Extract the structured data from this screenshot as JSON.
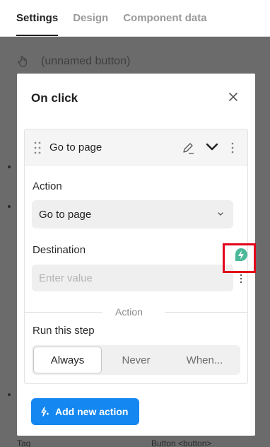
{
  "tabs": [
    {
      "label": "Settings",
      "active": true
    },
    {
      "label": "Design",
      "active": false
    },
    {
      "label": "Component data",
      "active": false
    }
  ],
  "background": {
    "component_name": "(unnamed button)",
    "bottom_left": "Tag",
    "bottom_right": "Button <button>"
  },
  "modal": {
    "title": "On click",
    "step": {
      "title": "Go to page",
      "action_label": "Action",
      "action_value": "Go to page",
      "destination_label": "Destination",
      "destination_placeholder": "Enter value",
      "separator_label": "Action",
      "run_label": "Run this step",
      "run_options": [
        "Always",
        "Never",
        "When..."
      ],
      "run_selected": "Always"
    },
    "add_button_label": "Add new action"
  },
  "colors": {
    "accent": "#1487f0",
    "highlight": "#e3001b",
    "dynamic_icon": "#3fb28f"
  }
}
